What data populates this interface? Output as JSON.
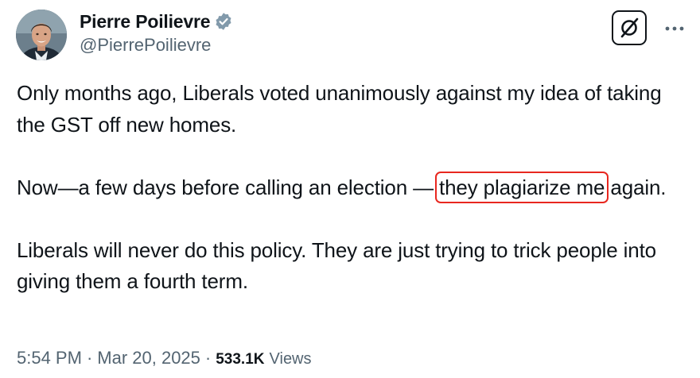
{
  "author": {
    "display_name": "Pierre Poilievre",
    "handle": "@PierrePoilievre",
    "verified": true,
    "verified_icon": "verified-badge-icon",
    "verified_color": "#829aab"
  },
  "actions": {
    "grok_icon": "grok-icon",
    "more_icon": "more-horizontal-icon"
  },
  "tweet": {
    "paragraphs": [
      "Only months ago, Liberals voted unanimously against my idea of taking the GST off new homes.",
      "Liberals will never do this policy. They are just trying to trick people into giving them a fourth term."
    ],
    "p2_before": "Now—a few days before calling an election — ",
    "p2_highlight": "they plagiarize me",
    "p2_after": " again.",
    "highlight_color": "#e8271f"
  },
  "meta": {
    "time": "5:54 PM",
    "date": "Mar 20, 2025",
    "separator": "·",
    "views_count": "533.1K",
    "views_label": "Views"
  }
}
